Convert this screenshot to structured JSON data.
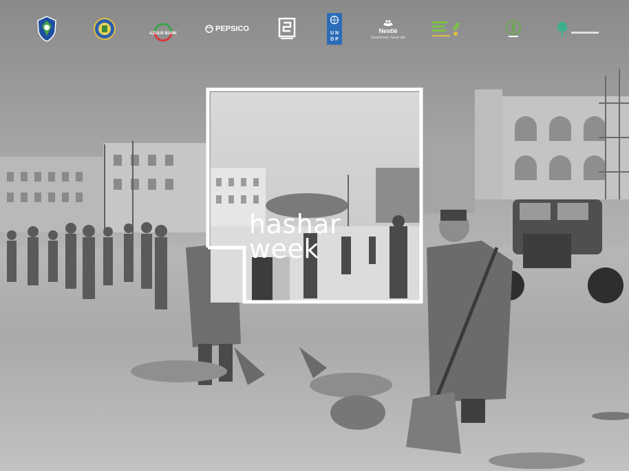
{
  "title": {
    "line1": "hashar",
    "line2": "week"
  },
  "logos": [
    {
      "name": "shield-logo",
      "text": ""
    },
    {
      "name": "emblem-logo",
      "text": ""
    },
    {
      "name": "bank-logo",
      "text": "AZOUS BANK"
    },
    {
      "name": "pepsico-logo",
      "text": "PEPSICO"
    },
    {
      "name": "square-logo",
      "text": ""
    },
    {
      "name": "undp-logo",
      "text": "U N D P"
    },
    {
      "name": "nestle-logo",
      "text": "Nestlé",
      "caption": "Good Food, Good Life"
    },
    {
      "name": "green-logo",
      "text": ""
    },
    {
      "name": "green-emblem-logo",
      "text": ""
    },
    {
      "name": "tree-logo",
      "text": ""
    }
  ],
  "colors": {
    "frame": "#ffffff",
    "text": "#ffffff",
    "undp_blue": "#2b6cb8"
  }
}
